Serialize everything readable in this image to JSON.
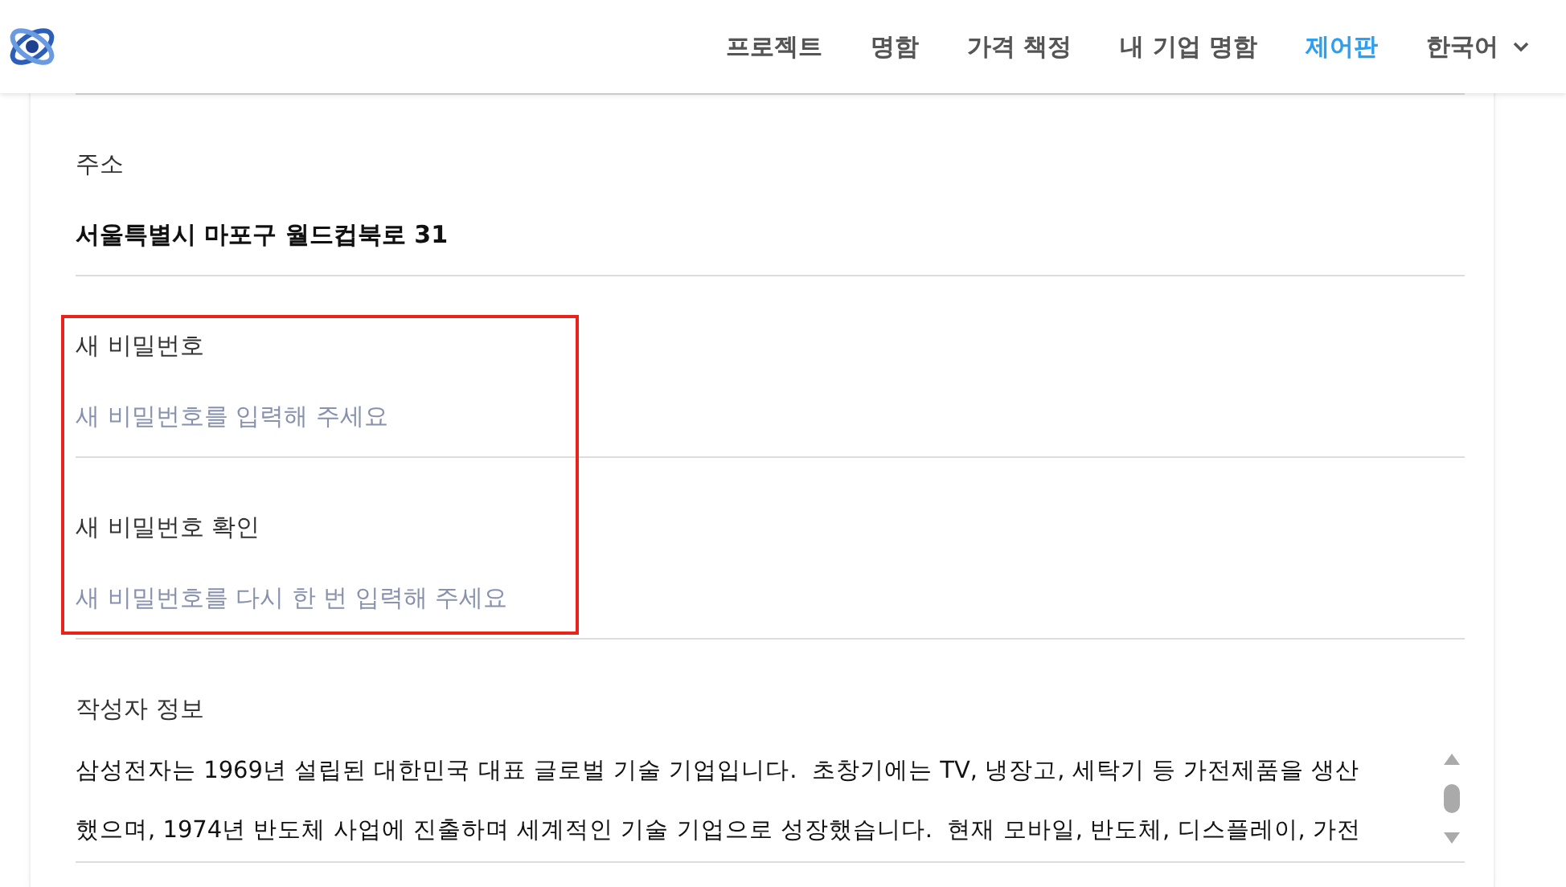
{
  "nav": {
    "items": [
      {
        "label": "프로젝트",
        "selected": false
      },
      {
        "label": "명함",
        "selected": false
      },
      {
        "label": "가격 책정",
        "selected": false
      },
      {
        "label": "내 기업 명함",
        "selected": false
      },
      {
        "label": "제어판",
        "selected": true
      }
    ],
    "language": "한국어"
  },
  "fields": [
    {
      "label": "주소",
      "value": "서울특별시 마포구 월드컵북로 31",
      "highlighted": false
    },
    {
      "label": "새 비밀번호",
      "placeholder": "새 비밀번호를 입력해 주세요",
      "highlighted": true
    },
    {
      "label": "새 비밀번호 확인",
      "placeholder": "새 비밀번호를 다시 한 번 입력해 주세요",
      "highlighted": true
    }
  ],
  "author_info": {
    "label": "작성자 정보",
    "lines": [
      "삼성전자는 1969년 설립된 대한민국 대표 글로벌 기술 기업입니다.  초창기에는 TV, 냉장고, 세탁기 등 가전제품을 생산",
      "했으며, 1974년 반도체 사업에 진출하며 세계적인 기술 기업으로 성장했습니다.  현재 모바일, 반도체, 디스플레이, 가전"
    ]
  }
}
